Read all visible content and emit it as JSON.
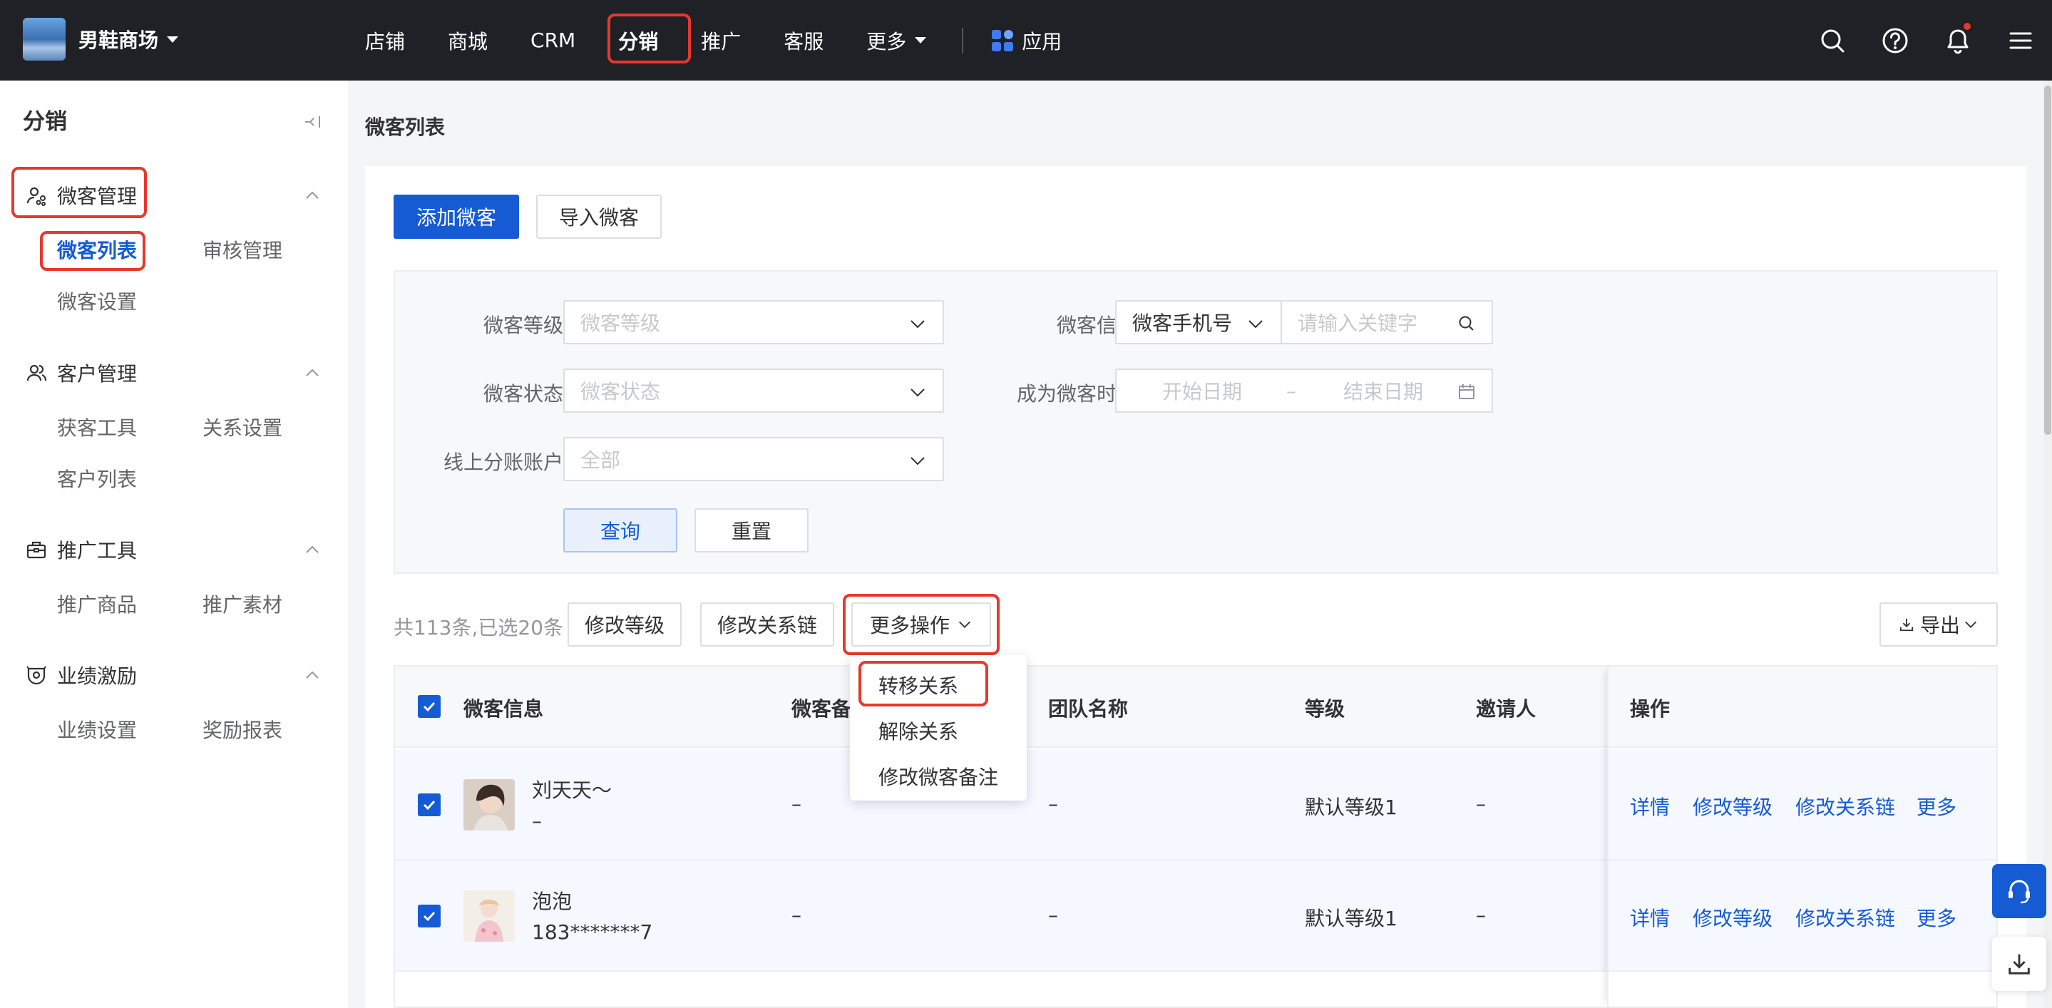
{
  "topnav": {
    "shop_name": "男鞋商场",
    "items": [
      "店铺",
      "商城",
      "CRM",
      "分销",
      "推广",
      "客服",
      "更多"
    ],
    "active": "分销",
    "apps_label": "应用"
  },
  "sidebar": {
    "title": "分销",
    "groups": [
      {
        "label": "微客管理",
        "items": [
          "微客列表",
          "审核管理",
          "微客设置"
        ]
      },
      {
        "label": "客户管理",
        "items": [
          "获客工具",
          "关系设置",
          "客户列表"
        ]
      },
      {
        "label": "推广工具",
        "items": [
          "推广商品",
          "推广素材"
        ]
      },
      {
        "label": "业绩激励",
        "items": [
          "业绩设置",
          "奖励报表"
        ]
      }
    ],
    "current_item": "微客列表"
  },
  "page": {
    "title": "微客列表",
    "add_button": "添加微客",
    "import_button": "导入微客"
  },
  "filters": {
    "level_label": "微客等级",
    "level_placeholder": "微客等级",
    "info_label": "微客信息",
    "info_type": "微客手机号",
    "keyword_placeholder": "请输入关键字",
    "status_label": "微客状态",
    "status_placeholder": "微客状态",
    "time_label": "成为微客时间",
    "start_placeholder": "开始日期",
    "range_sep": "–",
    "end_placeholder": "结束日期",
    "account_label": "线上分账账户",
    "account_value": "全部",
    "query_button": "查询",
    "reset_button": "重置"
  },
  "toolbar": {
    "summary": "共113条,已选20条",
    "modify_level": "修改等级",
    "modify_chain": "修改关系链",
    "more_ops": "更多操作",
    "export": "导出"
  },
  "dropdown": {
    "items": [
      "转移关系",
      "解除关系",
      "修改微客备注"
    ]
  },
  "table": {
    "columns": [
      "微客信息",
      "微客备",
      "团队名称",
      "等级",
      "邀请人",
      "操作"
    ],
    "rows": [
      {
        "name": "刘天天～",
        "phone": "–",
        "remark": "–",
        "team": "–",
        "level": "默认等级1",
        "inviter": "–"
      },
      {
        "name": "泡泡",
        "phone": "183*******7",
        "remark": "–",
        "team": "–",
        "level": "默认等级1",
        "inviter": "–"
      }
    ],
    "actions": [
      "详情",
      "修改等级",
      "修改关系链",
      "更多"
    ]
  },
  "colors": {
    "primary": "#155bd4",
    "highlight": "#e8382b",
    "topbar": "#1f2127"
  }
}
